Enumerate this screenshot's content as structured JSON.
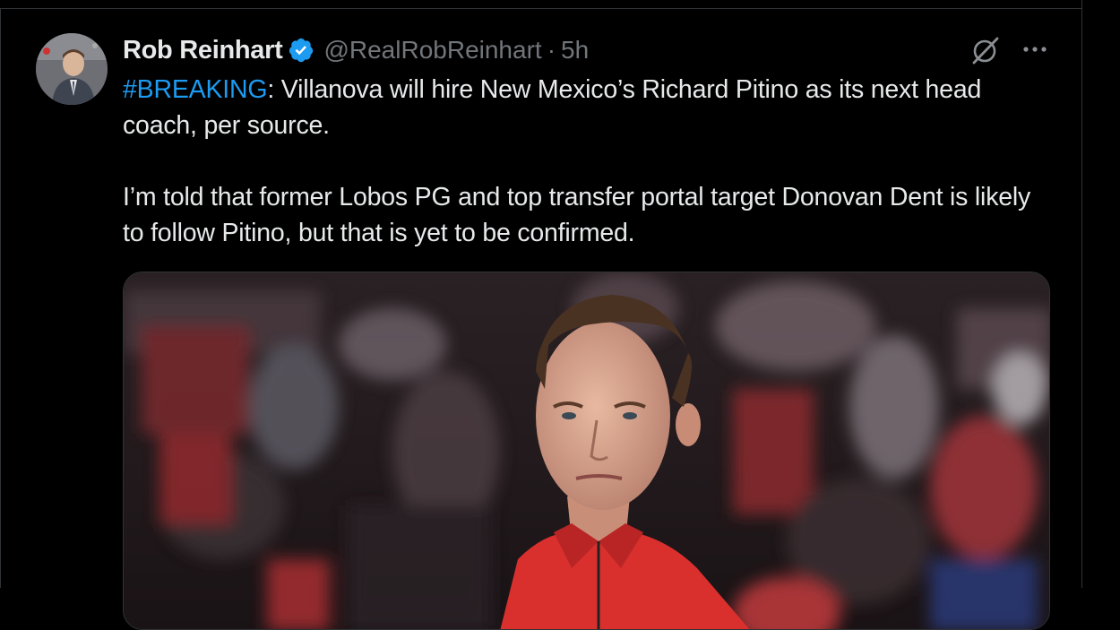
{
  "tweet": {
    "author": {
      "name": "Rob Reinhart",
      "handle": "@RealRobReinhart",
      "verified": true,
      "avatar_icon": "profile-photo"
    },
    "separator": "·",
    "timestamp": "5h",
    "hashtag": "#BREAKING",
    "text_line1_rest": ": Villanova will hire New Mexico’s Richard Pitino as its next head coach, per source.",
    "text_paragraph2": "I’m told that former Lobos PG and top transfer portal target Donovan Dent is likely to follow Pitino, but that is yet to be confirmed.",
    "actions": {
      "grok_icon": "grok-icon",
      "more_icon": "more-icon"
    },
    "media": {
      "type": "photo",
      "subject": "coach in red quarter-zip in front of blurred crowd"
    }
  },
  "colors": {
    "background": "#000000",
    "text": "#e7e9ea",
    "secondary": "#71767b",
    "link": "#1d9bf0",
    "verified": "#1d9bf0"
  }
}
